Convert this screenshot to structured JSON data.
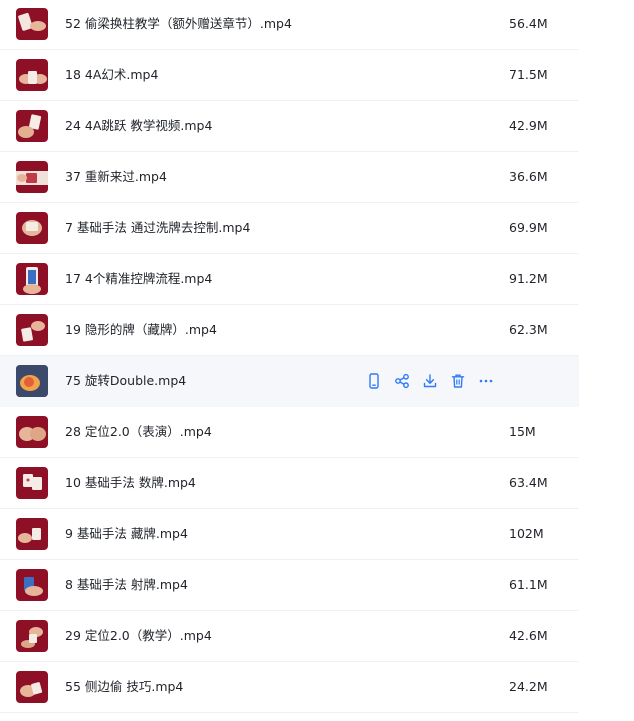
{
  "colors": {
    "accent": "#2f7bf5",
    "text": "#1f2329",
    "row_hover": "#f5f7fb",
    "divider": "#f0f1f3",
    "thumb_bg": "#8e1026"
  },
  "hover_actions": [
    {
      "name": "phone-icon"
    },
    {
      "name": "share-icon"
    },
    {
      "name": "download-icon"
    },
    {
      "name": "delete-icon"
    },
    {
      "name": "more-icon"
    }
  ],
  "files": [
    {
      "name": "52 偷梁换柱教学（额外赠送章节）.mp4",
      "size": "56.4M"
    },
    {
      "name": "18 4A幻术.mp4",
      "size": "71.5M"
    },
    {
      "name": "24 4A跳跃 教学视频.mp4",
      "size": "42.9M"
    },
    {
      "name": "37 重新来过.mp4",
      "size": "36.6M"
    },
    {
      "name": "7 基础手法 通过洗牌去控制.mp4",
      "size": "69.9M"
    },
    {
      "name": "17 4个精准控牌流程.mp4",
      "size": "91.2M"
    },
    {
      "name": "19 隐形的牌（藏牌）.mp4",
      "size": "62.3M"
    },
    {
      "name": "75 旋转Double.mp4",
      "size": ""
    },
    {
      "name": "28 定位2.0（表演）.mp4",
      "size": "15M"
    },
    {
      "name": "10 基础手法 数牌.mp4",
      "size": "63.4M"
    },
    {
      "name": "9 基础手法 藏牌.mp4",
      "size": "102M"
    },
    {
      "name": "8 基础手法 射牌.mp4",
      "size": "61.1M"
    },
    {
      "name": "29 定位2.0（教学）.mp4",
      "size": "42.6M"
    },
    {
      "name": "55 侧边偷 技巧.mp4",
      "size": "24.2M"
    }
  ]
}
